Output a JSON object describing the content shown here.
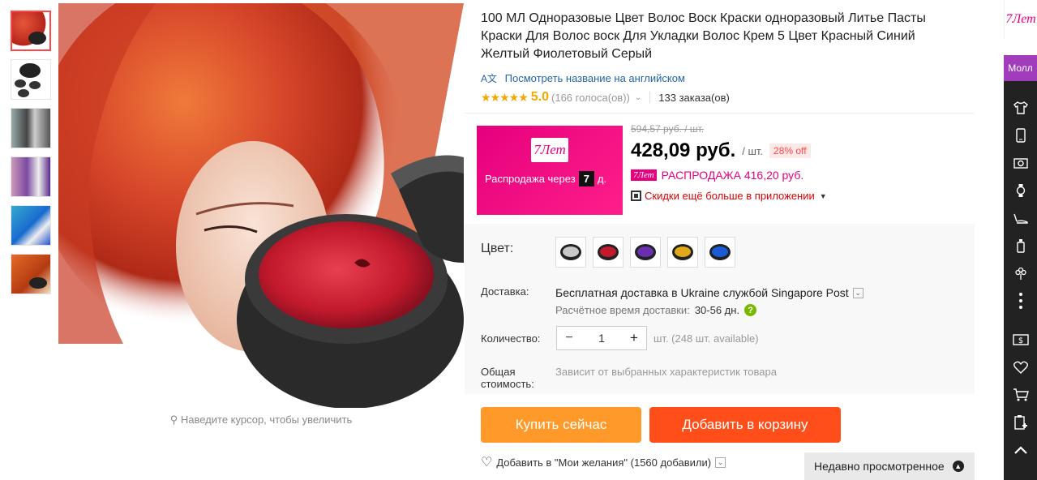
{
  "product": {
    "title": "100 МЛ Одноразовые Цвет Волос Воск Краски одноразовый Литье Пасты Краски Для Волос воск Для Укладки Волос Крем 5 Цвет Красный Синий Желтый Фиолетовый Серый",
    "translate_link": "Посмотреть название на английском",
    "rating_value": "5.0",
    "votes": "(166 голоса(ов))",
    "orders": "133 заказа(ов)"
  },
  "zoom_hint": "Наведите курсор, чтобы увеличить",
  "promo": {
    "logo": "7Лет",
    "text": "Распродажа через",
    "days": "7",
    "days_unit": "д."
  },
  "price": {
    "old": "594,57 руб. / шт.",
    "current": "428,09 руб.",
    "unit": "/ шт.",
    "discount": "28% off",
    "sale_logo": "7Лет",
    "sale_text": "РАСПРОДАЖА 416,20 руб.",
    "app_text": "Скидки ещё больше в приложении"
  },
  "options": {
    "color_label": "Цвет:",
    "delivery_label": "Доставка:",
    "delivery_text": "Бесплатная доставка в Ukraine службой Singapore Post",
    "delivery_time": "Расчётное время доставки:",
    "delivery_days": "30-56 дн.",
    "qty_label": "Количество:",
    "qty_value": "1",
    "qty_note": "шт. (248 шт. available)",
    "total_label_1": "Общая",
    "total_label_2": "стоимость:",
    "total_text": "Зависит от выбранных характеристик товара"
  },
  "buttons": {
    "buy": "Купить сейчас",
    "cart": "Добавить в корзину"
  },
  "wishlist": "Добавить в \"Мои желания\" (1560 добавили)",
  "recent": "Недавно просмотренное",
  "sidebar": {
    "logo": "7Лет",
    "mall": "Молл"
  },
  "colors": {
    "accent": "#ff4747",
    "buy": "#ff9a2a",
    "cart": "#ff4e1a",
    "promo": "#e5007d"
  }
}
